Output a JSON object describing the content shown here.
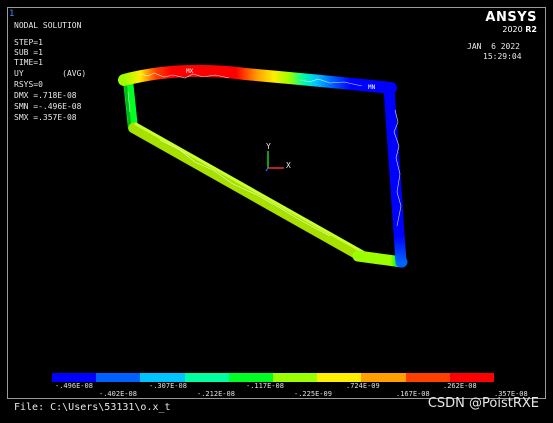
{
  "window_number": "1",
  "title": "NODAL SOLUTION",
  "info": {
    "step": "STEP=1",
    "sub": "SUB =1",
    "time": "TIME=1",
    "uy": "UY        (AVG)",
    "rsys": "RSYS=0",
    "dmx": "DMX =.718E-08",
    "smn": "SMN =-.496E-08",
    "smx": "SMX =.357E-08"
  },
  "brand": {
    "logo": "ANSYS",
    "version_year": "2020",
    "version_release": "R2"
  },
  "datetime": {
    "date": "JAN  6 2022",
    "time": "15:29:04"
  },
  "triad": {
    "y_label": "Y",
    "x_label": "X"
  },
  "model_labels": {
    "mx": "MX",
    "mn": "MN"
  },
  "legend": {
    "colors": [
      "#0000ff",
      "#0061ff",
      "#00c4ff",
      "#00ffa0",
      "#00ff22",
      "#9cff00",
      "#ffee00",
      "#ffa000",
      "#ff4000",
      "#ff0000"
    ],
    "top_labels": [
      "-.496E-08",
      "-.307E-08",
      "-.117E-08",
      ".724E-09",
      ".262E-08"
    ],
    "bottom_labels": [
      "-.402E-08",
      "-.212E-08",
      "-.225E-09",
      ".167E-08",
      ".357E-08"
    ]
  },
  "file_label": "File: C:\\Users\\53131\\o.x_t",
  "watermark": "CSDN @PoistRXE"
}
